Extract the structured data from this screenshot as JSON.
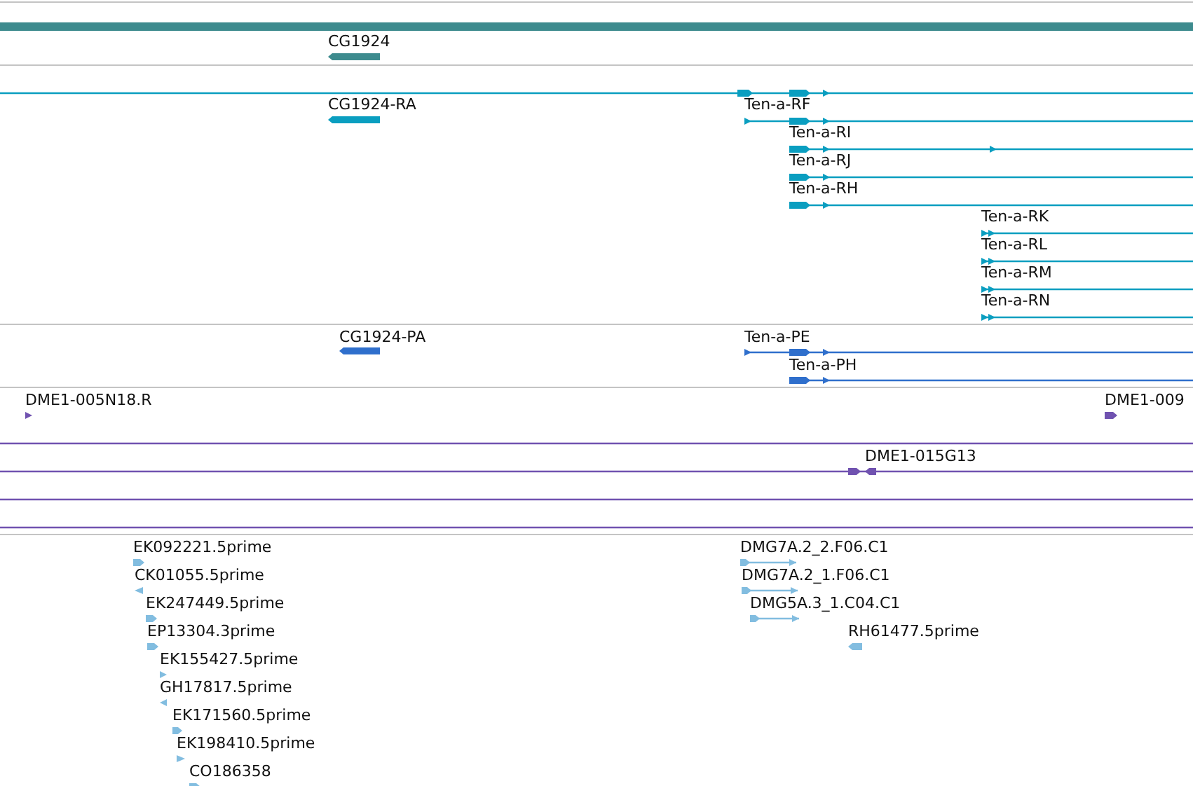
{
  "tracks": [
    {
      "color": "#3d8b8e",
      "features": [
        {
          "kind": "block",
          "label": "CG1924",
          "reverse": true
        }
      ]
    },
    {
      "color": "#0a9ec0",
      "features": [
        {
          "kind": "transcript",
          "reverse": false
        },
        {
          "kind": "block",
          "label": "CG1924-RA",
          "reverse": true
        },
        {
          "kind": "transcript",
          "label": "Ten-a-RF",
          "reverse": false
        },
        {
          "kind": "transcript",
          "label": "Ten-a-RI",
          "reverse": false
        },
        {
          "kind": "transcript",
          "label": "Ten-a-RJ",
          "reverse": false
        },
        {
          "kind": "transcript",
          "label": "Ten-a-RH",
          "reverse": false
        },
        {
          "kind": "transcript",
          "label": "Ten-a-RK",
          "reverse": false
        },
        {
          "kind": "transcript",
          "label": "Ten-a-RL",
          "reverse": false
        },
        {
          "kind": "transcript",
          "label": "Ten-a-RM",
          "reverse": false
        },
        {
          "kind": "transcript",
          "label": "Ten-a-RN",
          "reverse": false
        }
      ]
    },
    {
      "color": "#2f6fcc",
      "features": [
        {
          "kind": "block",
          "label": "CG1924-PA",
          "reverse": true
        },
        {
          "kind": "transcript",
          "label": "Ten-a-PE",
          "reverse": false
        },
        {
          "kind": "transcript",
          "label": "Ten-a-PH",
          "reverse": false
        }
      ]
    },
    {
      "color": "#7052b0",
      "features": [
        {
          "kind": "block",
          "label": "DME1-005N18.R",
          "reverse": false
        },
        {
          "kind": "block",
          "label": "DME1-009",
          "reverse": false
        },
        {
          "kind": "line"
        },
        {
          "kind": "transcript",
          "label": "DME1-015G13",
          "reverse": false
        },
        {
          "kind": "line"
        },
        {
          "kind": "line"
        }
      ]
    },
    {
      "color": "#82bde0",
      "features": [
        {
          "kind": "block",
          "label": "EK092221.5prime",
          "reverse": false
        },
        {
          "kind": "block",
          "label": "CK01055.5prime",
          "reverse": true
        },
        {
          "kind": "block",
          "label": "EK247449.5prime",
          "reverse": false
        },
        {
          "kind": "block",
          "label": "EP13304.3prime",
          "reverse": false
        },
        {
          "kind": "block",
          "label": "EK155427.5prime",
          "reverse": false
        },
        {
          "kind": "block",
          "label": "GH17817.5prime",
          "reverse": true
        },
        {
          "kind": "block",
          "label": "EK171560.5prime",
          "reverse": false
        },
        {
          "kind": "block",
          "label": "EK198410.5prime",
          "reverse": false
        },
        {
          "kind": "block",
          "label": "CO186358",
          "reverse": false
        },
        {
          "kind": "pair",
          "label": "DMG7A.2_2.F06.C1",
          "reverse": false
        },
        {
          "kind": "pair",
          "label": "DMG7A.2_1.F06.C1",
          "reverse": false
        },
        {
          "kind": "pair",
          "label": "DMG5A.3_1.C04.C1",
          "reverse": false
        },
        {
          "kind": "block",
          "label": "RH61477.5prime",
          "reverse": true
        }
      ]
    }
  ]
}
